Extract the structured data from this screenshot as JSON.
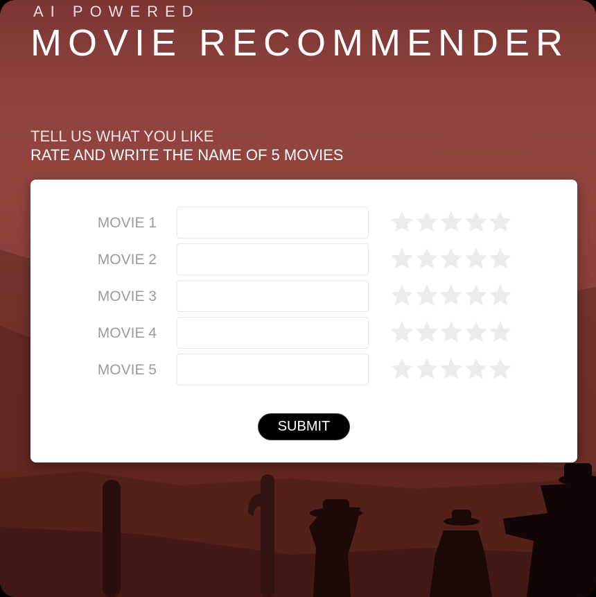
{
  "header": {
    "eyebrow": "AI POWERED",
    "title": "MOVIE RECOMMENDER"
  },
  "intro": {
    "subtitle": "TELL US WHAT YOU LIKE",
    "instructions": "RATE AND WRITE THE NAME OF 5 MOVIES"
  },
  "form": {
    "rows": [
      {
        "label": "MOVIE 1",
        "value": "",
        "rating": 0
      },
      {
        "label": "MOVIE 2",
        "value": "",
        "rating": 0
      },
      {
        "label": "MOVIE 3",
        "value": "",
        "rating": 0
      },
      {
        "label": "MOVIE 4",
        "value": "",
        "rating": 0
      },
      {
        "label": "MOVIE 5",
        "value": "",
        "rating": 0
      }
    ],
    "max_rating": 5,
    "submit_label": "SUBMIT"
  },
  "colors": {
    "background_tint": "#8e423f",
    "card": "#ffffff",
    "star_empty": "#ececec",
    "label": "#9c9c9c",
    "button": "#000000"
  }
}
